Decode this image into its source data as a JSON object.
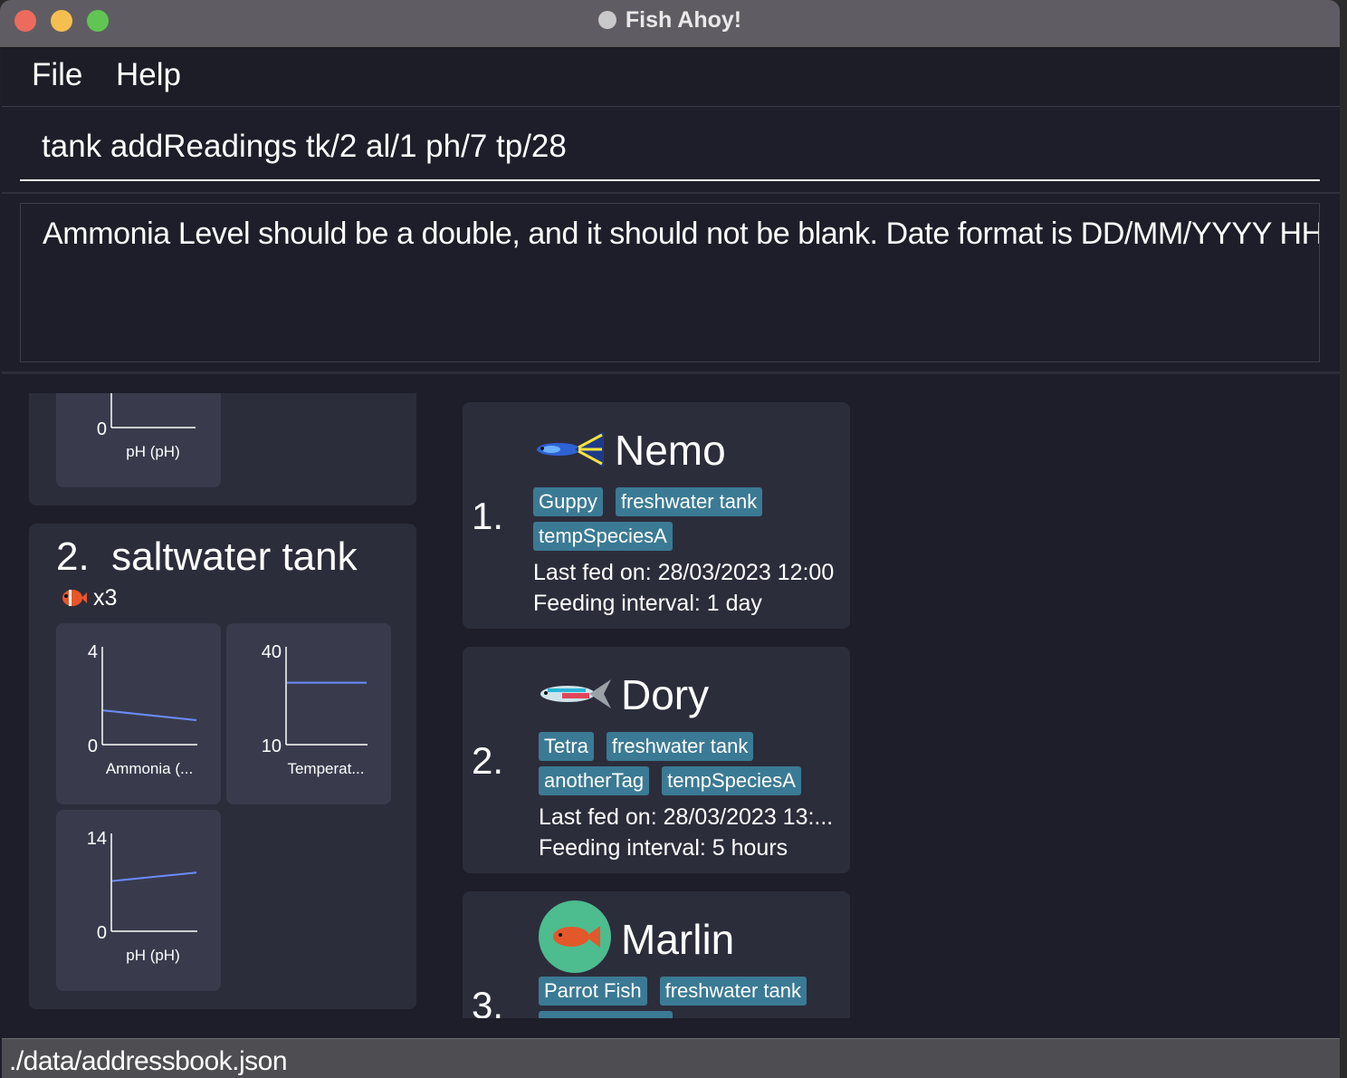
{
  "window": {
    "title": "Fish Ahoy!"
  },
  "menu": {
    "file": "File",
    "help": "Help"
  },
  "command": {
    "value": "tank addReadings tk/2 al/1 ph/7 tp/28"
  },
  "result": {
    "text": "Ammonia Level should be a double, and it should not be blank. Date format is DD/MM/YYYY HH:m"
  },
  "tanks": {
    "tank1": {
      "chart_ph": {
        "ymin": "0",
        "label": "pH (pH)"
      }
    },
    "tank2": {
      "index": "2.",
      "name": "saltwater tank",
      "fish_count": "x3",
      "chart_ammonia": {
        "ymax": "4",
        "ymin": "0",
        "label": "Ammonia (..."
      },
      "chart_temp": {
        "ymax": "40",
        "ymin": "10",
        "label": "Temperat..."
      },
      "chart_ph": {
        "ymax": "14",
        "ymin": "0",
        "label": "pH (pH)"
      }
    }
  },
  "chart_data": [
    {
      "type": "line",
      "title": "",
      "xlabel": "Ammonia (...",
      "ylabel": "",
      "ylim": [
        0,
        4
      ],
      "series": [
        {
          "values": [
            1.4,
            1.0
          ]
        }
      ]
    },
    {
      "type": "line",
      "title": "",
      "xlabel": "Temperat...",
      "ylabel": "",
      "ylim": [
        10,
        40
      ],
      "series": [
        {
          "values": [
            29,
            29
          ]
        }
      ]
    },
    {
      "type": "line",
      "title": "",
      "xlabel": "pH (pH)",
      "ylabel": "",
      "ylim": [
        0,
        14
      ],
      "series": [
        {
          "values": [
            7.2,
            8.4
          ]
        }
      ]
    }
  ],
  "fish": [
    {
      "index": "1.",
      "name": "Nemo",
      "icon": "guppy-fish-icon",
      "tags": [
        "Guppy",
        "freshwater tank",
        "tempSpeciesA"
      ],
      "last_fed": "Last fed on: 28/03/2023 12:00",
      "interval": "Feeding interval: 1 day"
    },
    {
      "index": "2.",
      "name": "Dory",
      "icon": "tetra-fish-icon",
      "tags": [
        "Tetra",
        "freshwater tank",
        "anotherTag",
        "tempSpeciesA"
      ],
      "last_fed": "Last fed on: 28/03/2023 13:...",
      "interval": "Feeding interval: 5 hours"
    },
    {
      "index": "3.",
      "name": "Marlin",
      "icon": "parrot-fish-icon",
      "tags": [
        "Parrot Fish",
        "freshwater tank"
      ]
    }
  ],
  "status": {
    "path": "./data/addressbook.json"
  },
  "colors": {
    "accent_tag": "#3b7a94",
    "chart_line": "#6b8cff",
    "background": "#1d1e29",
    "card": "#2c2d3b"
  }
}
